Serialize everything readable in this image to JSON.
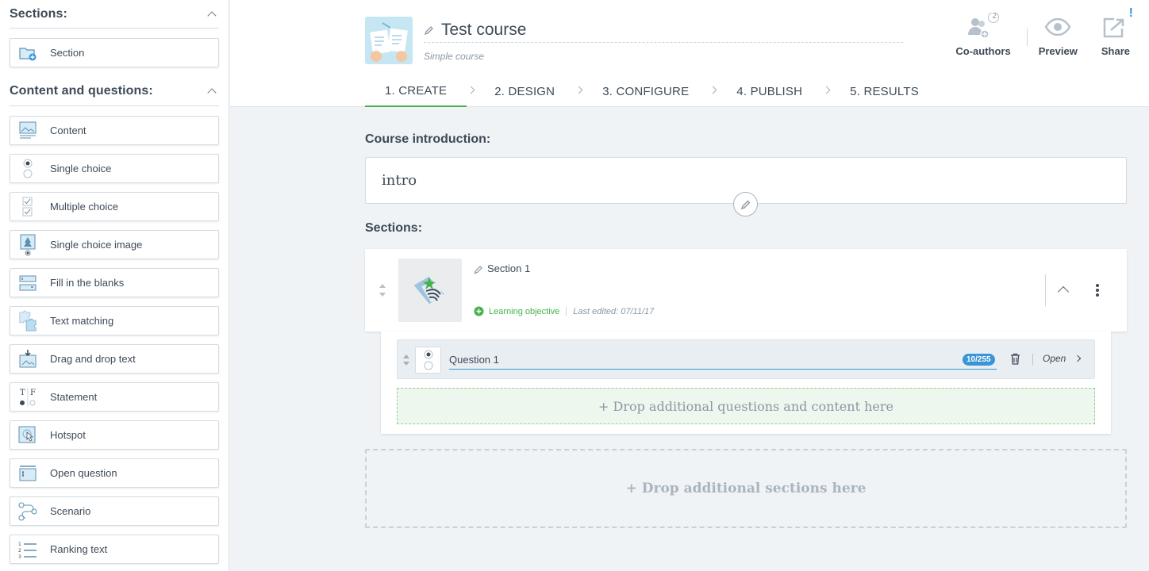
{
  "sidebar": {
    "sections_header": "Sections:",
    "section_items": [
      {
        "label": "Section",
        "icon": "folder-add-icon"
      }
    ],
    "content_header": "Content and questions:",
    "content_items": [
      {
        "label": "Content",
        "icon": "content-image-icon"
      },
      {
        "label": "Single choice",
        "icon": "single-choice-icon"
      },
      {
        "label": "Multiple choice",
        "icon": "multiple-choice-icon"
      },
      {
        "label": "Single choice image",
        "icon": "single-choice-image-icon"
      },
      {
        "label": "Fill in the blanks",
        "icon": "fill-blanks-icon"
      },
      {
        "label": "Text matching",
        "icon": "puzzle-icon"
      },
      {
        "label": "Drag and drop text",
        "icon": "drag-drop-icon"
      },
      {
        "label": "Statement",
        "icon": "true-false-icon"
      },
      {
        "label": "Hotspot",
        "icon": "hotspot-icon"
      },
      {
        "label": "Open question",
        "icon": "open-question-icon"
      },
      {
        "label": "Scenario",
        "icon": "scenario-icon"
      },
      {
        "label": "Ranking text",
        "icon": "ranking-icon"
      }
    ]
  },
  "header": {
    "course_title": "Test course",
    "course_subtitle": "Simple course",
    "coauthors_label": "Co-authors",
    "coauthors_count": "2",
    "preview_label": "Preview",
    "share_label": "Share",
    "share_badge": "!"
  },
  "tabs": [
    "1. CREATE",
    "2. DESIGN",
    "3. CONFIGURE",
    "4. PUBLISH",
    "5. RESULTS"
  ],
  "main": {
    "intro_label": "Course introduction:",
    "intro_text": "intro",
    "sections_label": "Sections:",
    "section": {
      "title": "Section 1",
      "learning_objective": "Learning objective",
      "last_edited": "Last edited: 07/11/17"
    },
    "question": {
      "value": "Question 1",
      "char_count": "10/255",
      "open_label": "Open"
    },
    "drop_questions": "+ Drop additional questions and content here",
    "drop_sections": "+ Drop additional sections here"
  },
  "colors": {
    "accent_green": "#46b24a",
    "accent_blue": "#3a95d6",
    "text": "#3d4a57"
  }
}
